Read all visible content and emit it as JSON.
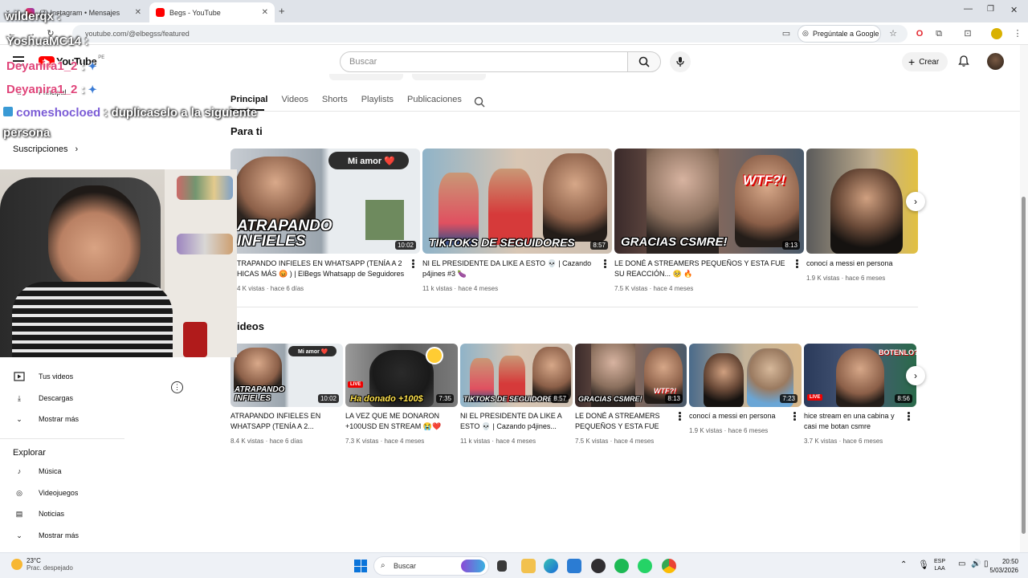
{
  "browser": {
    "tabs": [
      {
        "label": "(7) Instagram • Mensajes"
      },
      {
        "label": "Begs - YouTube"
      }
    ],
    "url": "youtube.com/@elbegss/featured",
    "ask_google": "Pregúntale a Google"
  },
  "youtube": {
    "logo_text": "YouTube",
    "region": "PE",
    "search_placeholder": "Buscar",
    "create_label": "Crear"
  },
  "channel_tabs": [
    "Principal",
    "Videos",
    "Shorts",
    "Playlists",
    "Publicaciones"
  ],
  "for_you": {
    "title": "Para ti",
    "videos": [
      {
        "title": "ATRAPANDO INFIELES EN WHATSAPP (TENÍA A 2 CHICAS MÁS 😡 ) | ElBegs Whatsapp de Seguidores",
        "title_visible": "TRAPANDO INFIELES EN WHATSAPP (TENÍA A 2 HICAS MÁS 😡 ) | ElBegs Whatsapp de Seguidores",
        "views": "4 K vistas",
        "age": "hace 6 días",
        "duration": "10:02",
        "overlay": "ATRAPANDO INFIELES",
        "chip": "Mi amor ❤️"
      },
      {
        "title": "NI EL PRESIDENTE DA LIKE A ESTO 💀 | Cazando p4jines #3 🍆",
        "views": "11 k vistas",
        "age": "hace 4 meses",
        "duration": "8:57",
        "overlay": "TIKTOKS DE SEGUIDORES"
      },
      {
        "title": "LE DONÉ A STREAMERS PEQUEÑOS Y ESTA FUE SU REACCIÓN... 🥺 🔥",
        "views": "7.5 K vistas",
        "age": "hace 4 meses",
        "duration": "8:13",
        "overlay": "GRACIAS CSMRE!",
        "chip": "WTF?!"
      },
      {
        "title": "conocí a messi en persona",
        "views": "1.9 K vistas",
        "age": "hace 6 meses"
      }
    ]
  },
  "videos_section": {
    "title": "Videos",
    "title_visible": "ideos",
    "videos": [
      {
        "title": "ATRAPANDO INFIELES EN WHATSAPP (TENÍA A 2...",
        "views": "8.4 K vistas",
        "age": "hace 6 días",
        "duration": "10:02",
        "overlay": "ATRAPANDO INFIELES",
        "chip": "Mi amor ❤️"
      },
      {
        "title": "LA VEZ QUE ME DONARON +100USD EN STREAM 😭❤️",
        "views": "7.3 K vistas",
        "age": "hace 4 meses",
        "duration": "7:35",
        "overlay": "Ha donado +100$",
        "live": "LIVE"
      },
      {
        "title": "NI EL PRESIDENTE DA LIKE A ESTO 💀 | Cazando p4jines...",
        "views": "11 k vistas",
        "age": "hace 4 meses",
        "duration": "8:57",
        "overlay": "TIKTOKS DE SEGUIDORES"
      },
      {
        "title": "LE DONÉ A STREAMERS PEQUEÑOS Y ESTA FUE SU...",
        "views": "7.5 K vistas",
        "age": "hace 4 meses",
        "duration": "8:13",
        "overlay": "GRACIAS CSMRE!",
        "chip": "WTF?!"
      },
      {
        "title": "conocí a messi en persona",
        "views": "1.9 K vistas",
        "age": "hace 6 meses",
        "duration": "7:23"
      },
      {
        "title": "hice stream en una cabina y casi me botan csmre",
        "views": "3.7 K vistas",
        "age": "hace 6 meses",
        "duration": "8:56",
        "overlay": "BOTENLO?",
        "live": "LIVE"
      }
    ]
  },
  "sidebar": {
    "principal": "Principal",
    "subscriptions": "Suscripciones",
    "your_videos": "Tus videos",
    "downloads": "Descargas",
    "show_more": "Mostrar más",
    "explore": "Explorar",
    "music": "Música",
    "games": "Videojuegos",
    "news": "Noticias",
    "show_more_2": "Mostrar más"
  },
  "chat_overlay": [
    {
      "user": "wilderqx",
      "message": ":"
    },
    {
      "user": "YoshuaMC14",
      "message": ":"
    },
    {
      "user": "Deyanira1_2",
      "message": ":"
    },
    {
      "user": "Deyanira1_2",
      "message": ":"
    },
    {
      "user": "comeshocloed",
      "message": ": duplicaselo a la siguiente",
      "message_2": "persona"
    }
  ],
  "taskbar": {
    "weather_temp": "23°C",
    "weather_desc": "Prac. despejado",
    "search": "Buscar",
    "lang_1": "ESP",
    "lang_2": "LAA",
    "time": "20:50",
    "date": "5/03/2026"
  },
  "colors": {
    "youtube_red": "#ff0000",
    "chat_purple": "#7b5cd6",
    "chat_pink": "#e0457a"
  }
}
